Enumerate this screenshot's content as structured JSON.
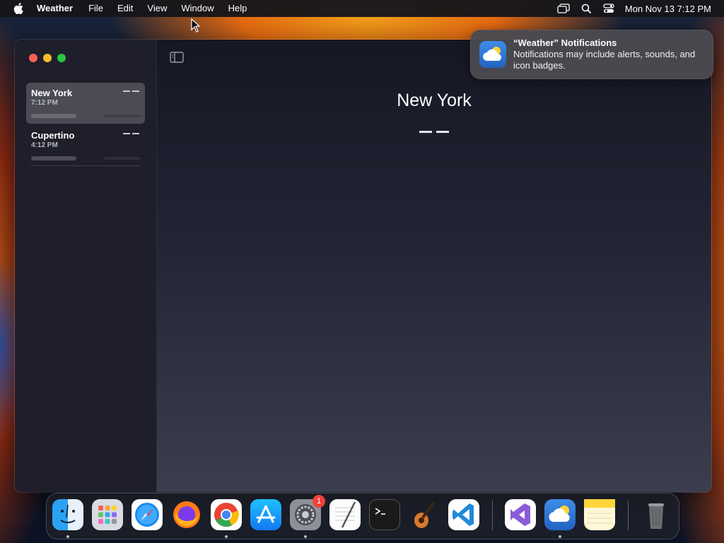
{
  "menubar": {
    "app_name": "Weather",
    "menus": [
      "File",
      "Edit",
      "View",
      "Window",
      "Help"
    ],
    "clock": "Mon Nov 13  7:12 PM"
  },
  "sidebar": {
    "cities": [
      {
        "name": "New York",
        "time": "7:12 PM",
        "selected": true
      },
      {
        "name": "Cupertino",
        "time": "4:12 PM",
        "selected": false
      }
    ]
  },
  "main": {
    "city": "New York"
  },
  "notification": {
    "title": "“Weather” Notifications",
    "body": "Notifications may include alerts, sounds, and icon badges."
  },
  "dock": {
    "items": [
      "finder-icon",
      "launchpad-icon",
      "safari-icon",
      "firefox-icon",
      "chrome-icon",
      "app-store-icon",
      "system-settings-icon",
      "textedit-icon",
      "terminal-icon",
      "garageband-icon",
      "vscode-icon",
      "visual-studio-icon",
      "weather-icon",
      "notes-icon",
      "trash-icon"
    ],
    "system_settings_badge": "1"
  }
}
